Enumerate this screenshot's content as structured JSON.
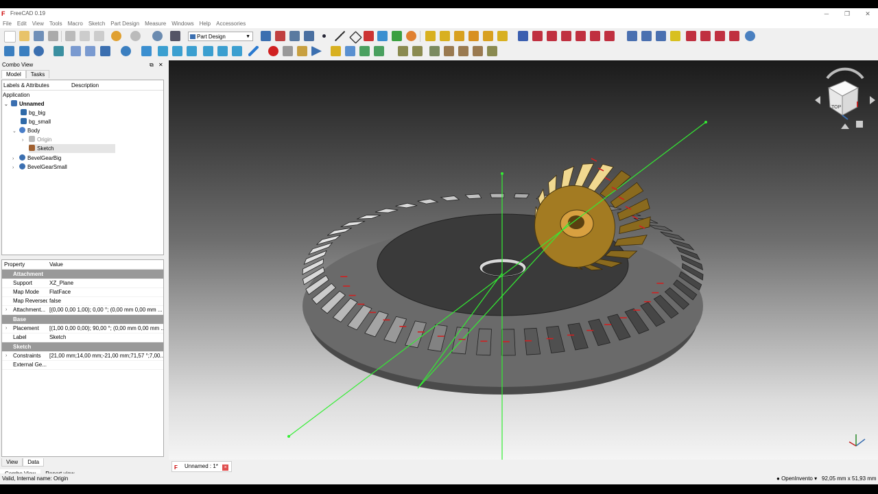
{
  "app": {
    "title": "FreeCAD 0.19"
  },
  "window_buttons": {
    "minimize": "─",
    "restore": "❐",
    "close": "✕"
  },
  "menu": [
    "File",
    "Edit",
    "View",
    "Tools",
    "Macro",
    "Sketch",
    "Part Design",
    "Measure",
    "Windows",
    "Help",
    "Accessories"
  ],
  "workbench": {
    "selected": "Part Design"
  },
  "combo_view": {
    "title": "Combo View",
    "tabs": [
      "Model",
      "Tasks"
    ],
    "bottom_tabs": [
      "View",
      "Data"
    ]
  },
  "tree": {
    "headers": [
      "Labels & Attributes",
      "Description"
    ],
    "section": "Application",
    "items": [
      {
        "label": "Unnamed",
        "icon": "document-icon",
        "color": "#3b6fb0",
        "bold": true
      },
      {
        "label": "bg_big",
        "icon": "spreadsheet-icon",
        "color": "#2f6aa8"
      },
      {
        "label": "bg_small",
        "icon": "spreadsheet-icon",
        "color": "#2f6aa8"
      },
      {
        "label": "Body",
        "icon": "body-icon",
        "color": "#4a7ec8"
      },
      {
        "label": "Origin",
        "icon": "origin-icon",
        "color": "#888888"
      },
      {
        "label": "Sketch",
        "icon": "sketch-icon",
        "color": "#a06030"
      },
      {
        "label": "BevelGearBig",
        "icon": "gear-icon",
        "color": "#3b6fb0"
      },
      {
        "label": "BevelGearSmall",
        "icon": "gear-icon",
        "color": "#3b6fb0"
      }
    ]
  },
  "properties": {
    "headers": [
      "Property",
      "Value"
    ],
    "rows": [
      {
        "group": "Attachment"
      },
      {
        "name": "Support",
        "value": "XZ_Plane"
      },
      {
        "name": "Map Mode",
        "value": "FlatFace"
      },
      {
        "name": "Map Reversed",
        "value": "false"
      },
      {
        "name": "Attachment...",
        "value": "[(0,00 0,00 1,00); 0,00 °; (0,00 mm  0,00 mm  ..."
      },
      {
        "group": "Base"
      },
      {
        "name": "Placement",
        "value": "[(1,00 0,00 0,00); 90,00 °; (0,00 mm  0,00 mm  ..."
      },
      {
        "name": "Label",
        "value": "Sketch"
      },
      {
        "group": "Sketch"
      },
      {
        "name": "Constraints",
        "value": "[21,00 mm;14,00 mm;-21,00 mm;71,57 °;7,00..."
      },
      {
        "name": "External Ge...",
        "value": ""
      }
    ]
  },
  "dock_tabs": [
    "Combo View",
    "Report view"
  ],
  "document_tab": {
    "label": "Unnamed : 1*"
  },
  "navcube": {
    "face": "TOP"
  },
  "status": {
    "message": "Valid, Internal name: Origin",
    "nav_style": "OpenInvento",
    "dimensions": "92,05 mm x 51,93 mm"
  },
  "colors": {
    "accent": "#3b6fb0",
    "axis_green": "#33dd33",
    "gear_small": "#8a6a1e",
    "gear_big": "#888888",
    "sketch_red": "#d02020"
  }
}
